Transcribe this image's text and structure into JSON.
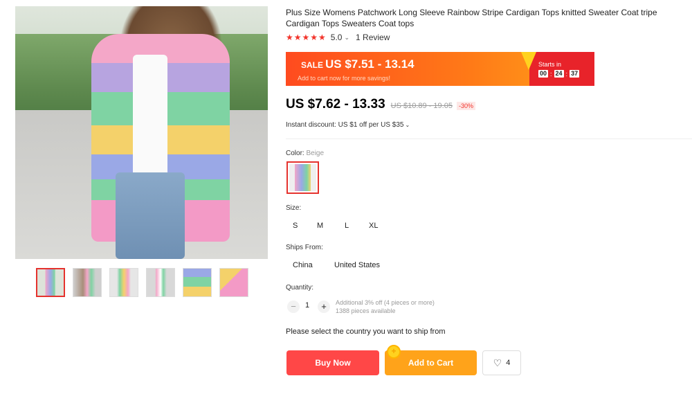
{
  "product": {
    "title": "Plus Size Womens Patchwork Long Sleeve Rainbow Stripe Cardigan Tops knitted Sweater Coat tripe Cardigan Tops Sweaters Coat tops",
    "rating": {
      "stars": "★★★★★",
      "score": "5.0",
      "chevron": "⌄",
      "reviews": "1 Review"
    }
  },
  "sale": {
    "label": "SALE",
    "price": "US $7.51 - 13.14",
    "subtext": "Add to cart now for more savings!",
    "starts_in": "Starts in",
    "countdown": [
      "00",
      "24",
      "37"
    ],
    "separator": ":"
  },
  "pricing": {
    "price": "US $7.62 - 13.33",
    "old_price": "US $10.89 - 19.05",
    "discount": "-30%",
    "instant_discount": "Instant discount: US $1 off per US $35",
    "instant_chevron": "⌄"
  },
  "color": {
    "label": "Color:",
    "value": "Beige"
  },
  "size": {
    "label": "Size:",
    "options": [
      "S",
      "M",
      "L",
      "XL"
    ]
  },
  "ships_from": {
    "label": "Ships From:",
    "options": [
      "China",
      "United States"
    ]
  },
  "quantity": {
    "label": "Quantity:",
    "minus": "−",
    "plus": "+",
    "value": "1",
    "info_line1": "Additional 3% off (4 pieces or more)",
    "info_line2": "1388 pieces available"
  },
  "ship_message": "Please select the country you want to ship from",
  "actions": {
    "buy_now": "Buy Now",
    "add_to_cart": "Add to Cart",
    "cart_badge": "+",
    "wishlist_heart": "♡",
    "wishlist_count": "4"
  },
  "colors": {
    "accent_red": "#ff4747",
    "accent_orange": "#ffa31a",
    "star_red": "#f2342b",
    "sale_gradient_start": "#ff4b1f",
    "sale_gradient_end": "#ffa31a"
  }
}
